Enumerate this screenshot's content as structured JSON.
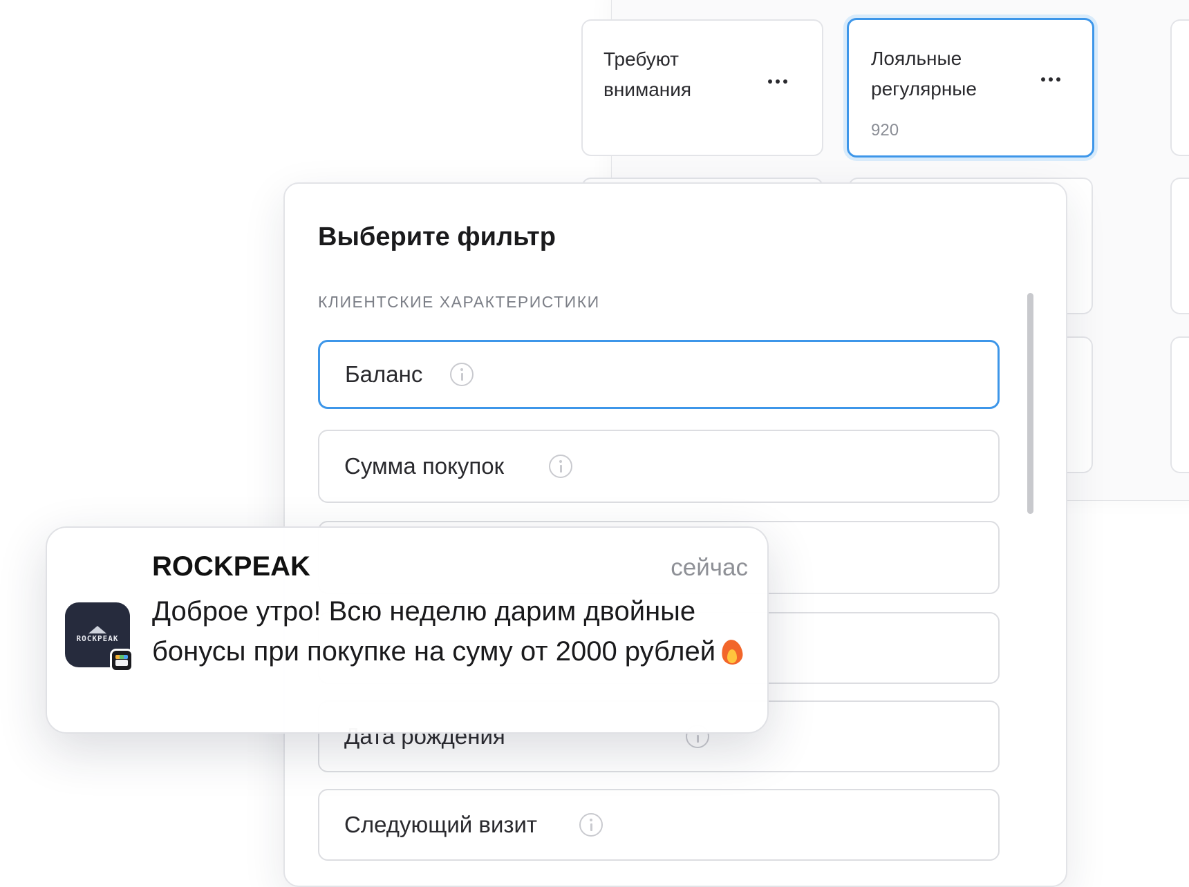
{
  "segments": [
    {
      "title": "Требуют\nвнимания",
      "count": ""
    },
    {
      "title": "Лояльные\nрегулярные",
      "count": "920"
    }
  ],
  "filter_panel": {
    "title": "Выберите фильтр",
    "section_label": "КЛИЕНТСКИЕ ХАРАКТЕРИСТИКИ",
    "items": [
      {
        "label": "Баланс"
      },
      {
        "label": "Сумма покупок"
      },
      {
        "label": ""
      },
      {
        "label": ""
      },
      {
        "label": "Дата рождения"
      },
      {
        "label": "Следующий визит"
      }
    ]
  },
  "notification": {
    "app_name": "ROCKPEAK",
    "time": "сейчас",
    "body": "Доброе утро! Всю неделю дарим двойные бонусы при покупке на суму от 2000 рублей",
    "emoji_icon": "fire-icon",
    "app_icon_text": "ROCKPEAK"
  },
  "colors": {
    "accent": "#3d96e9",
    "border": "#dcdde1",
    "muted_text": "#8a8d95"
  }
}
